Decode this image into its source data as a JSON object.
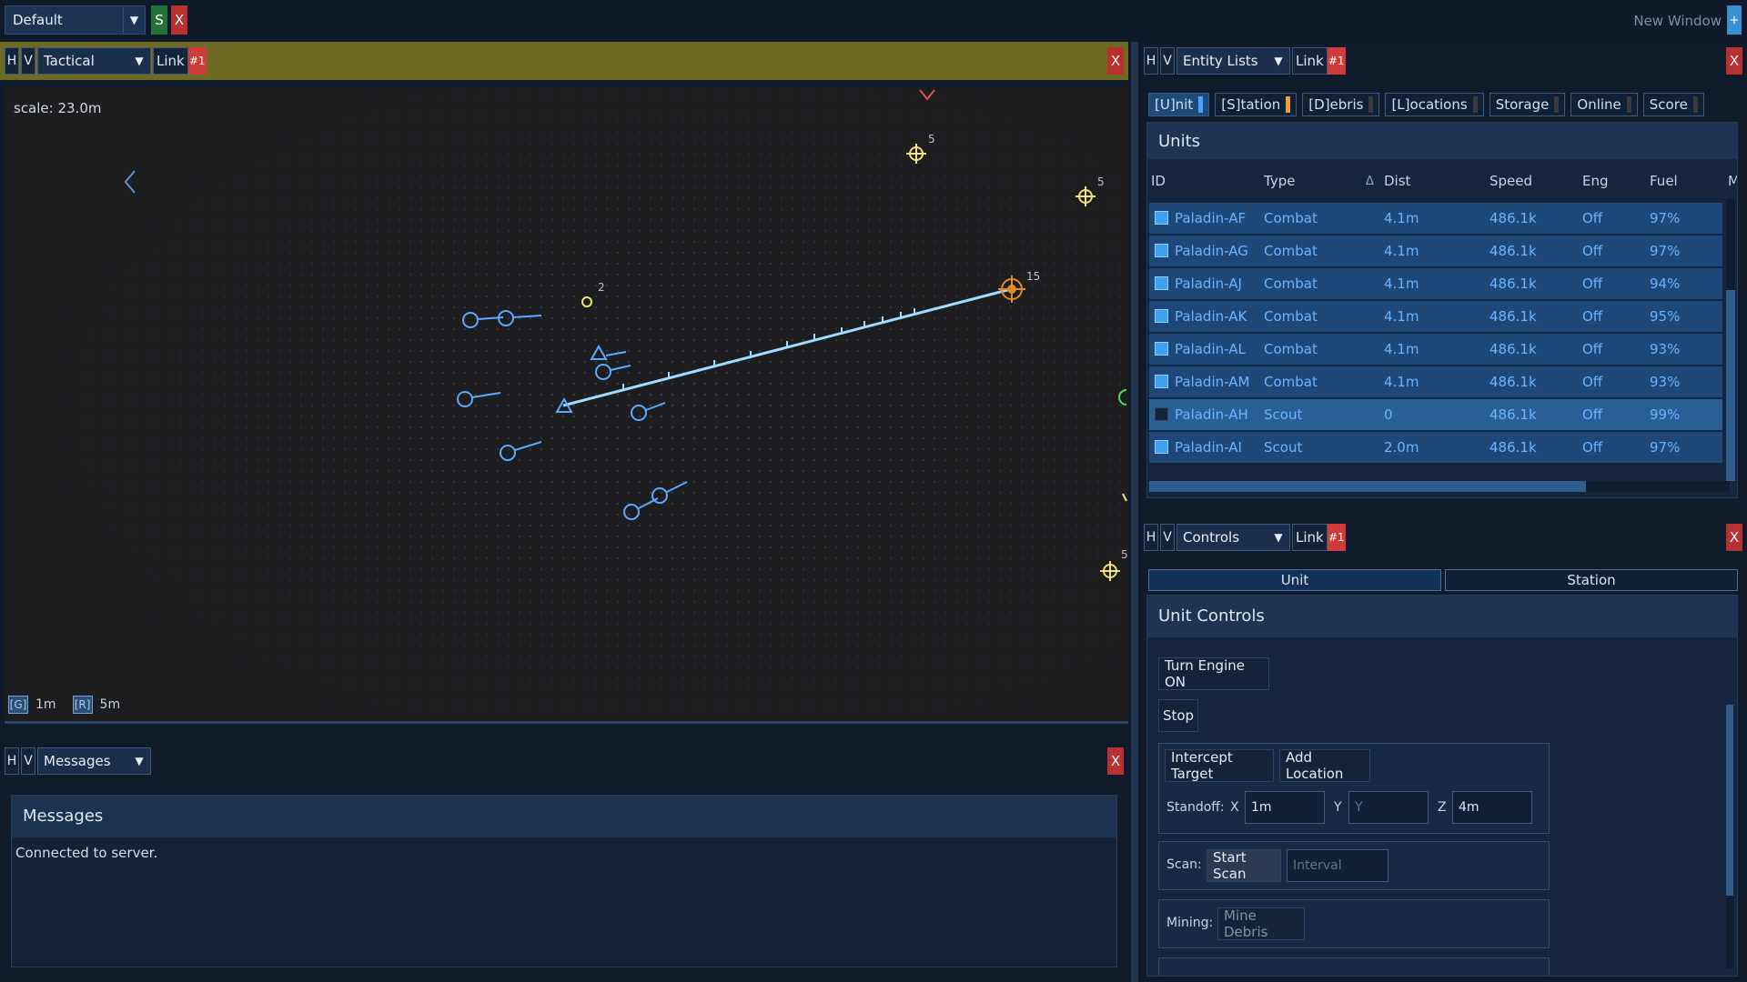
{
  "topbar": {
    "layout_value": "Default",
    "save_label": "S",
    "close_label": "X",
    "new_window_label": "New Window",
    "new_window_plus": "+"
  },
  "tactical": {
    "h_label": "H",
    "v_label": "V",
    "view_value": "Tactical",
    "link_label": "Link",
    "link_num": "#1",
    "close_label": "X",
    "scale_text": "scale: 23.0m",
    "grid_key": "[G]",
    "grid_value": "1m",
    "range_key": "[R]",
    "range_value": "5m",
    "marker_labels": [
      "5",
      "5",
      "2",
      "15",
      "5"
    ]
  },
  "messages": {
    "h_label": "H",
    "v_label": "V",
    "view_value": "Messages",
    "close_label": "X",
    "title": "Messages",
    "lines": [
      "Connected to server."
    ]
  },
  "entity_lists": {
    "h_label": "H",
    "v_label": "V",
    "view_value": "Entity Lists",
    "link_label": "Link",
    "link_num": "#1",
    "close_label": "X",
    "tabs": [
      {
        "label": "[U]nit",
        "color": "#4aa3ff"
      },
      {
        "label": "[S]tation",
        "color": "#f0a030"
      },
      {
        "label": "[D]ebris",
        "color": "#3a3a3a"
      },
      {
        "label": "[L]ocations",
        "color": "#3a3a3a"
      },
      {
        "label": "Storage",
        "color": "#3a3a3a"
      },
      {
        "label": "Online",
        "color": "#3a3a3a"
      },
      {
        "label": "Score",
        "color": "#3a3a3a"
      }
    ],
    "units_title": "Units",
    "columns": {
      "id": "ID",
      "type": "Type",
      "sort": "Δ",
      "dist": "Dist",
      "speed": "Speed",
      "eng": "Eng",
      "fuel": "Fuel",
      "more": "M"
    },
    "rows": [
      {
        "id": "Paladin-AF",
        "type": "Combat",
        "dist": "4.1m",
        "speed": "486.1k",
        "eng": "Off",
        "fuel": "97%"
      },
      {
        "id": "Paladin-AG",
        "type": "Combat",
        "dist": "4.1m",
        "speed": "486.1k",
        "eng": "Off",
        "fuel": "97%"
      },
      {
        "id": "Paladin-AJ",
        "type": "Combat",
        "dist": "4.1m",
        "speed": "486.1k",
        "eng": "Off",
        "fuel": "94%"
      },
      {
        "id": "Paladin-AK",
        "type": "Combat",
        "dist": "4.1m",
        "speed": "486.1k",
        "eng": "Off",
        "fuel": "95%"
      },
      {
        "id": "Paladin-AL",
        "type": "Combat",
        "dist": "4.1m",
        "speed": "486.1k",
        "eng": "Off",
        "fuel": "93%"
      },
      {
        "id": "Paladin-AM",
        "type": "Combat",
        "dist": "4.1m",
        "speed": "486.1k",
        "eng": "Off",
        "fuel": "93%"
      },
      {
        "id": "Paladin-AH",
        "type": "Scout",
        "dist": "0",
        "speed": "486.1k",
        "eng": "Off",
        "fuel": "99%"
      },
      {
        "id": "Paladin-AI",
        "type": "Scout",
        "dist": "2.0m",
        "speed": "486.1k",
        "eng": "Off",
        "fuel": "97%"
      }
    ]
  },
  "controls": {
    "h_label": "H",
    "v_label": "V",
    "view_value": "Controls",
    "link_label": "Link",
    "link_num": "#1",
    "close_label": "X",
    "tab_unit": "Unit",
    "tab_station": "Station",
    "title": "Unit Controls",
    "engine_button": "Turn Engine ON",
    "stop_button": "Stop",
    "intercept_button": "Intercept Target",
    "add_location_button": "Add Location",
    "standoff_label": "Standoff:",
    "x_label": "X",
    "x_value": "1m",
    "y_label": "Y",
    "y_placeholder": "Y",
    "z_label": "Z",
    "z_value": "4m",
    "scan_label": "Scan:",
    "start_scan_button": "Start Scan",
    "interval_placeholder": "Interval",
    "mining_label": "Mining:",
    "mine_debris_button": "Mine Debris"
  }
}
